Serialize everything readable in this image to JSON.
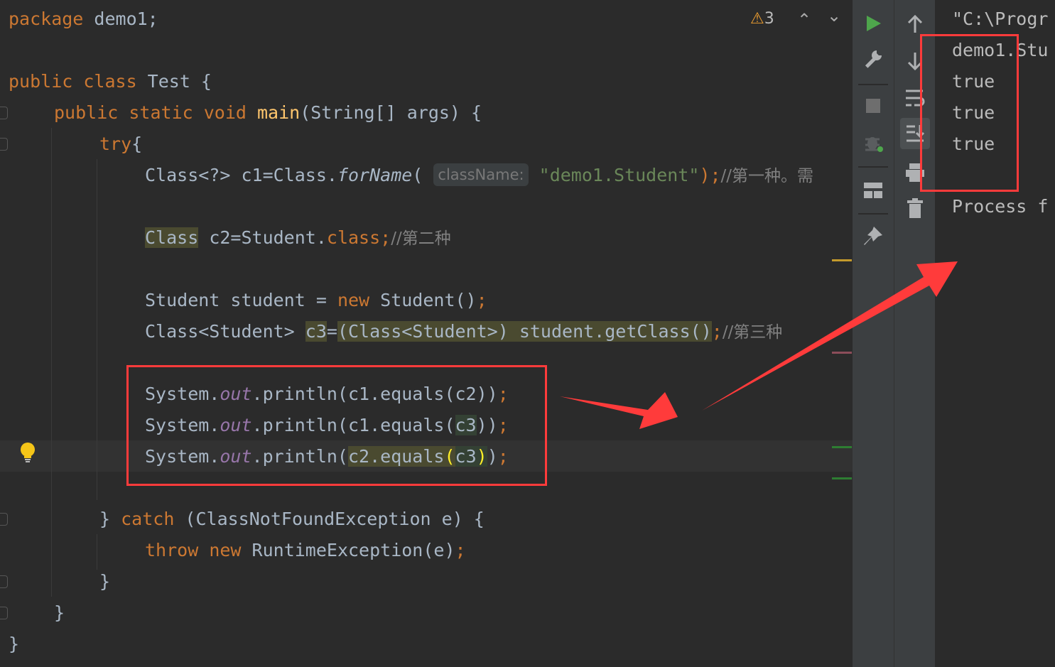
{
  "editor": {
    "warning_count": "3",
    "lines": {
      "pkg_kw": "package",
      "pkg_name": " demo1;",
      "class_public": "public",
      "class_kw": " class",
      "class_name": " Test {",
      "main_public": "public",
      "main_static": " static",
      "main_void": " void",
      "main_name": " main",
      "main_args": "(String[] args) {",
      "try_kw": "try",
      "try_brace": "{",
      "c1_decl": "Class<?> c1=Class.",
      "c1_forname": "forName",
      "c1_paren": "(",
      "c1_hint": "className:",
      "c1_str": "\"demo1.Student\"",
      "c1_close": ");",
      "c1_cmt": "//第一种。需",
      "c2_class": "Class",
      "c2_rest": " c2=Student.",
      "c2_classkw": "class",
      "c2_semi": ";",
      "c2_cmt": "//第二种",
      "stu_decl": "Student student = ",
      "stu_new": "new",
      "stu_ctor": " Student()",
      "stu_semi": ";",
      "c3_type": "Class<Student> ",
      "c3_var": "c3",
      "c3_eq": "=",
      "c3_cast": "(Class<Student>) student.getClass()",
      "c3_semi": ";",
      "c3_cmt": "//第三种",
      "p1_sys": "System.",
      "p1_out": "out",
      "p1_rest": ".println(c1.equals(c2))",
      "p1_semi": ";",
      "p2_sys": "System.",
      "p2_out": "out",
      "p2_a": ".println(c1.equals(",
      "p2_c3": "c3",
      "p2_b": "))",
      "p2_semi": ";",
      "p3_sys": "System.",
      "p3_out": "out",
      "p3_a": ".println(",
      "p3_hl": "c2.equals",
      "p3_po": "(",
      "p3_c3": "c3",
      "p3_pc": ")",
      "p3_b": ")",
      "p3_semi": ";",
      "catch_open": "} ",
      "catch_kw": "catch",
      "catch_rest": " (ClassNotFoundException e) {",
      "throw_kw": "throw",
      "throw_new": " new",
      "throw_rest": " RuntimeException(e)",
      "throw_semi": ";",
      "brace1": "}",
      "brace2": "}",
      "brace3": "}"
    }
  },
  "console": {
    "lines": [
      "\"C:\\Progr",
      "demo1.Stu",
      "true",
      "true",
      "true",
      "",
      "Process f"
    ]
  },
  "icons": {
    "run": "run-icon",
    "wrench": "wrench-icon",
    "stop": "stop-icon",
    "up": "arrow-up-icon",
    "down": "arrow-down-icon",
    "wrap": "soft-wrap-icon",
    "scroll": "scroll-to-end-icon",
    "print": "print-icon",
    "trash": "trash-icon",
    "pin": "pin-icon",
    "layout": "layout-icon",
    "debug": "debug-icon"
  },
  "colors": {
    "annotation": "#ff3b3b",
    "keyword": "#cc7832",
    "string": "#6a8759",
    "method": "#ffc66d"
  }
}
